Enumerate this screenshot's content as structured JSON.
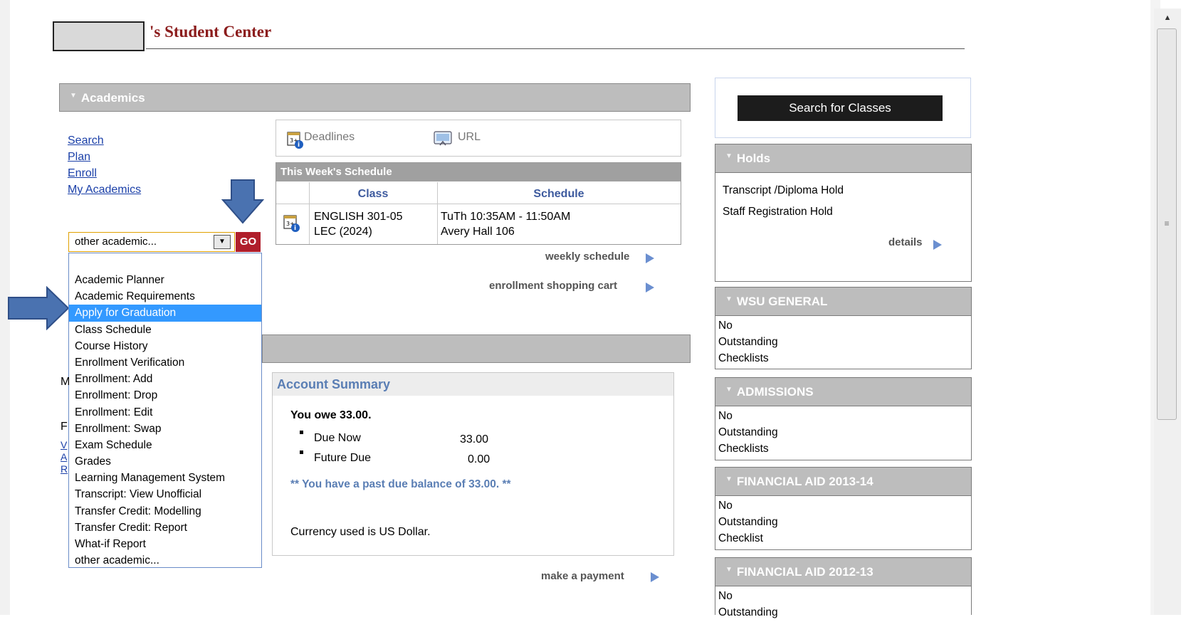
{
  "page": {
    "title": "'s Student Center"
  },
  "academics": {
    "header": "Academics",
    "links": [
      "Search",
      "Plan",
      "Enroll",
      "My Academics"
    ],
    "select_value": "other academic...",
    "go_label": "GO",
    "options": [
      "Academic Planner",
      "Academic Requirements",
      "Apply for Graduation",
      "Class Schedule",
      "Course History",
      "Enrollment Verification",
      "Enrollment: Add",
      "Enrollment: Drop",
      "Enrollment: Edit",
      "Enrollment: Swap",
      "Exam Schedule",
      "Grades",
      "Learning Management System",
      "Transcript: View Unofficial",
      "Transfer Credit: Modelling",
      "Transfer Credit: Report",
      "What-if Report",
      "other academic..."
    ],
    "highlighted_option_index": 2,
    "deadlines_label": "Deadlines",
    "url_label": "URL",
    "schedule": {
      "header": "This Week's Schedule",
      "col_class": "Class",
      "col_schedule": "Schedule",
      "row_class_line1": "ENGLISH 301-05",
      "row_class_line2": "LEC (2024)",
      "row_sched_line1": "TuTh 10:35AM - 11:50AM",
      "row_sched_line2": "Avery Hall 106"
    },
    "weekly_schedule_link": "weekly schedule",
    "shopping_cart_link": "enrollment shopping cart"
  },
  "finances": {
    "hidden_letters": [
      "M",
      "F",
      "V",
      "A",
      "R"
    ],
    "account_summary": {
      "header": "Account Summary",
      "owe": "You owe 33.00.",
      "due_now_label": "Due Now",
      "due_now_value": "33.00",
      "future_due_label": "Future Due",
      "future_due_value": "0.00",
      "past_due": "** You have a past due balance of 33.00. **",
      "currency": "Currency used is US Dollar."
    },
    "make_payment_link": "make a payment"
  },
  "sidebar": {
    "search_button": "Search for Classes",
    "holds": {
      "header": "Holds",
      "items": [
        "Transcript /Diploma Hold",
        "Staff Registration Hold"
      ],
      "details": "details"
    },
    "wsu_general": {
      "header": "WSU GENERAL",
      "lines": [
        "No",
        "Outstanding",
        "Checklists"
      ]
    },
    "admissions": {
      "header": "ADMISSIONS",
      "lines": [
        "No",
        "Outstanding",
        "Checklists"
      ]
    },
    "fa_2013": {
      "header": "FINANCIAL AID 2013-14",
      "lines": [
        "No",
        "Outstanding",
        "Checklist"
      ]
    },
    "fa_2012": {
      "header": "FINANCIAL AID 2012-13",
      "lines": [
        "No",
        "Outstanding"
      ]
    }
  },
  "icons": {
    "collapse": "triangle-down-icon",
    "deadlines": "calendar-info-icon",
    "url": "url-link-icon",
    "more": "play-arrow-icon",
    "annotation": "blue-arrow-icon"
  },
  "colors": {
    "title": "#8b1c1c",
    "header_bg": "#bdbdbd",
    "link": "#1a3fa8",
    "highlight": "#3399ff",
    "go_button": "#b01e2b",
    "annotation_arrow": "#4a72b0"
  }
}
